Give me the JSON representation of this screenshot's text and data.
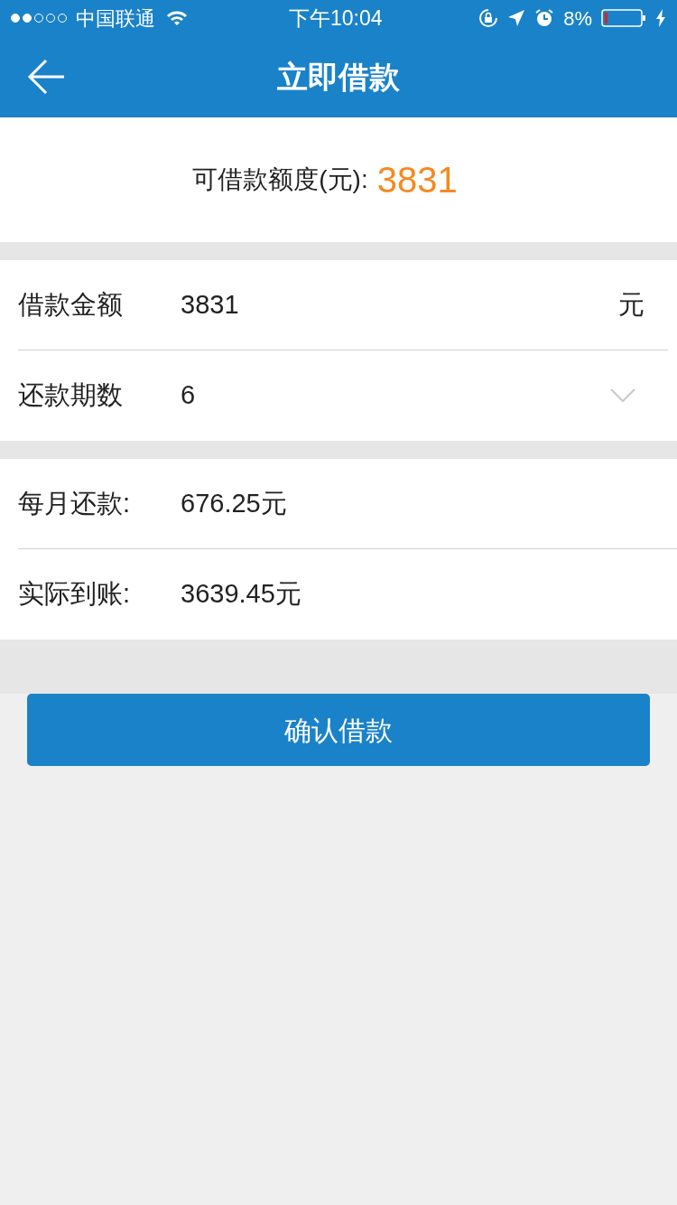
{
  "status_bar": {
    "carrier": "中国联通",
    "time": "下午10:04",
    "battery_percent": "8%"
  },
  "nav": {
    "title": "立即借款"
  },
  "credit": {
    "label": "可借款额度(元):",
    "amount": "3831"
  },
  "form": [
    {
      "kind": "input",
      "label": "借款金额",
      "value": "3831",
      "unit": "元"
    },
    {
      "kind": "select",
      "label": "还款期数",
      "value": "6"
    }
  ],
  "results": [
    {
      "label": "每月还款:",
      "value": "676.25元"
    },
    {
      "label": "实际到账:",
      "value": "3639.45元"
    }
  ],
  "submit_button": "确认借款"
}
